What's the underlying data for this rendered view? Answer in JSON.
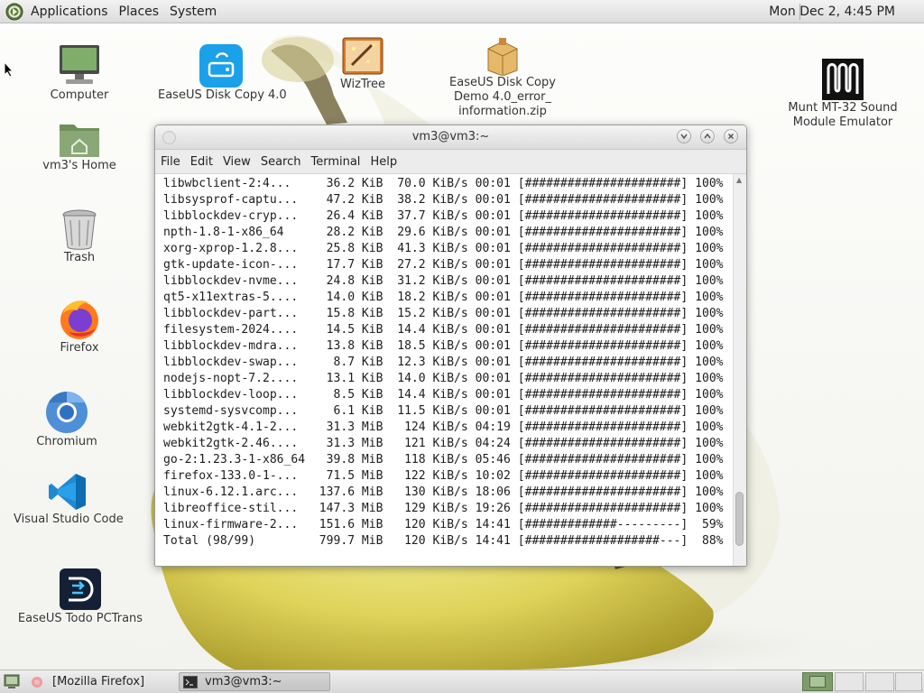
{
  "top_panel": {
    "menus": [
      "Applications",
      "Places",
      "System"
    ],
    "clock": "Mon Dec 2,  4:45 PM"
  },
  "desktop_icons": [
    {
      "label": "Computer",
      "icon": "computer-icon"
    },
    {
      "label": "vm3's Home",
      "icon": "home-folder-icon"
    },
    {
      "label": "Trash",
      "icon": "trash-icon"
    },
    {
      "label": "Firefox",
      "icon": "firefox-icon"
    },
    {
      "label": "Chromium",
      "icon": "chromium-icon"
    },
    {
      "label": "Visual Studio Code",
      "icon": "vscode-icon"
    },
    {
      "label": "EaseUS Todo PCTrans",
      "icon": "easeus-todo-pctrans-icon"
    },
    {
      "label": "EaseUS Disk Copy 4.0",
      "icon": "easeus-disk-copy-icon"
    },
    {
      "label": "WizTree",
      "icon": "wiztree-icon"
    },
    {
      "label_lines": [
        "EaseUS Disk Copy",
        "Demo 4.0_error_",
        "information.zip"
      ],
      "icon": "zip-archive-icon"
    },
    {
      "label_lines": [
        "Munt MT-32 Sound",
        "Module Emulator"
      ],
      "icon": "munt-icon"
    }
  ],
  "terminal": {
    "title": "vm3@vm3:~",
    "menus": [
      "File",
      "Edit",
      "View",
      "Search",
      "Terminal",
      "Help"
    ],
    "lines": [
      "libwbclient-2:4...     36.2 KiB  70.0 KiB/s 00:01 [######################] 100%",
      "libsysprof-captu...    47.2 KiB  38.2 KiB/s 00:01 [######################] 100%",
      "libblockdev-cryp...    26.4 KiB  37.7 KiB/s 00:01 [######################] 100%",
      "npth-1.8-1-x86_64      28.2 KiB  29.6 KiB/s 00:01 [######################] 100%",
      "xorg-xprop-1.2.8...    25.8 KiB  41.3 KiB/s 00:01 [######################] 100%",
      "gtk-update-icon-...    17.7 KiB  27.2 KiB/s 00:01 [######################] 100%",
      "libblockdev-nvme...    24.8 KiB  31.2 KiB/s 00:01 [######################] 100%",
      "qt5-x11extras-5....    14.0 KiB  18.2 KiB/s 00:01 [######################] 100%",
      "libblockdev-part...    15.8 KiB  15.2 KiB/s 00:01 [######################] 100%",
      "filesystem-2024....    14.5 KiB  14.4 KiB/s 00:01 [######################] 100%",
      "libblockdev-mdra...    13.8 KiB  18.5 KiB/s 00:01 [######################] 100%",
      "libblockdev-swap...     8.7 KiB  12.3 KiB/s 00:01 [######################] 100%",
      "nodejs-nopt-7.2....    13.1 KiB  14.0 KiB/s 00:01 [######################] 100%",
      "libblockdev-loop...     8.5 KiB  14.4 KiB/s 00:01 [######################] 100%",
      "systemd-sysvcomp...     6.1 KiB  11.5 KiB/s 00:01 [######################] 100%",
      "webkit2gtk-4.1-2...    31.3 MiB   124 KiB/s 04:19 [######################] 100%",
      "webkit2gtk-2.46....    31.3 MiB   121 KiB/s 04:24 [######################] 100%",
      "go-2:1.23.3-1-x86_64   39.8 MiB   118 KiB/s 05:46 [######################] 100%",
      "firefox-133.0-1-...    71.5 MiB   122 KiB/s 10:02 [######################] 100%",
      "linux-6.12.1.arc...   137.6 MiB   130 KiB/s 18:06 [######################] 100%",
      "libreoffice-stil...   147.3 MiB   129 KiB/s 19:26 [######################] 100%",
      "linux-firmware-2...   151.6 MiB   120 KiB/s 14:41 [#############---------]  59%",
      "Total (98/99)         799.7 MiB   120 KiB/s 14:41 [###################---]  88%"
    ]
  },
  "taskbar": {
    "tasks": [
      "[Mozilla Firefox]",
      "vm3@vm3:~"
    ]
  },
  "colors": {
    "workspace_active": "#7d9c6a",
    "terminal_bg": "#ffffff",
    "panel_bg": "#dcdcdc"
  }
}
